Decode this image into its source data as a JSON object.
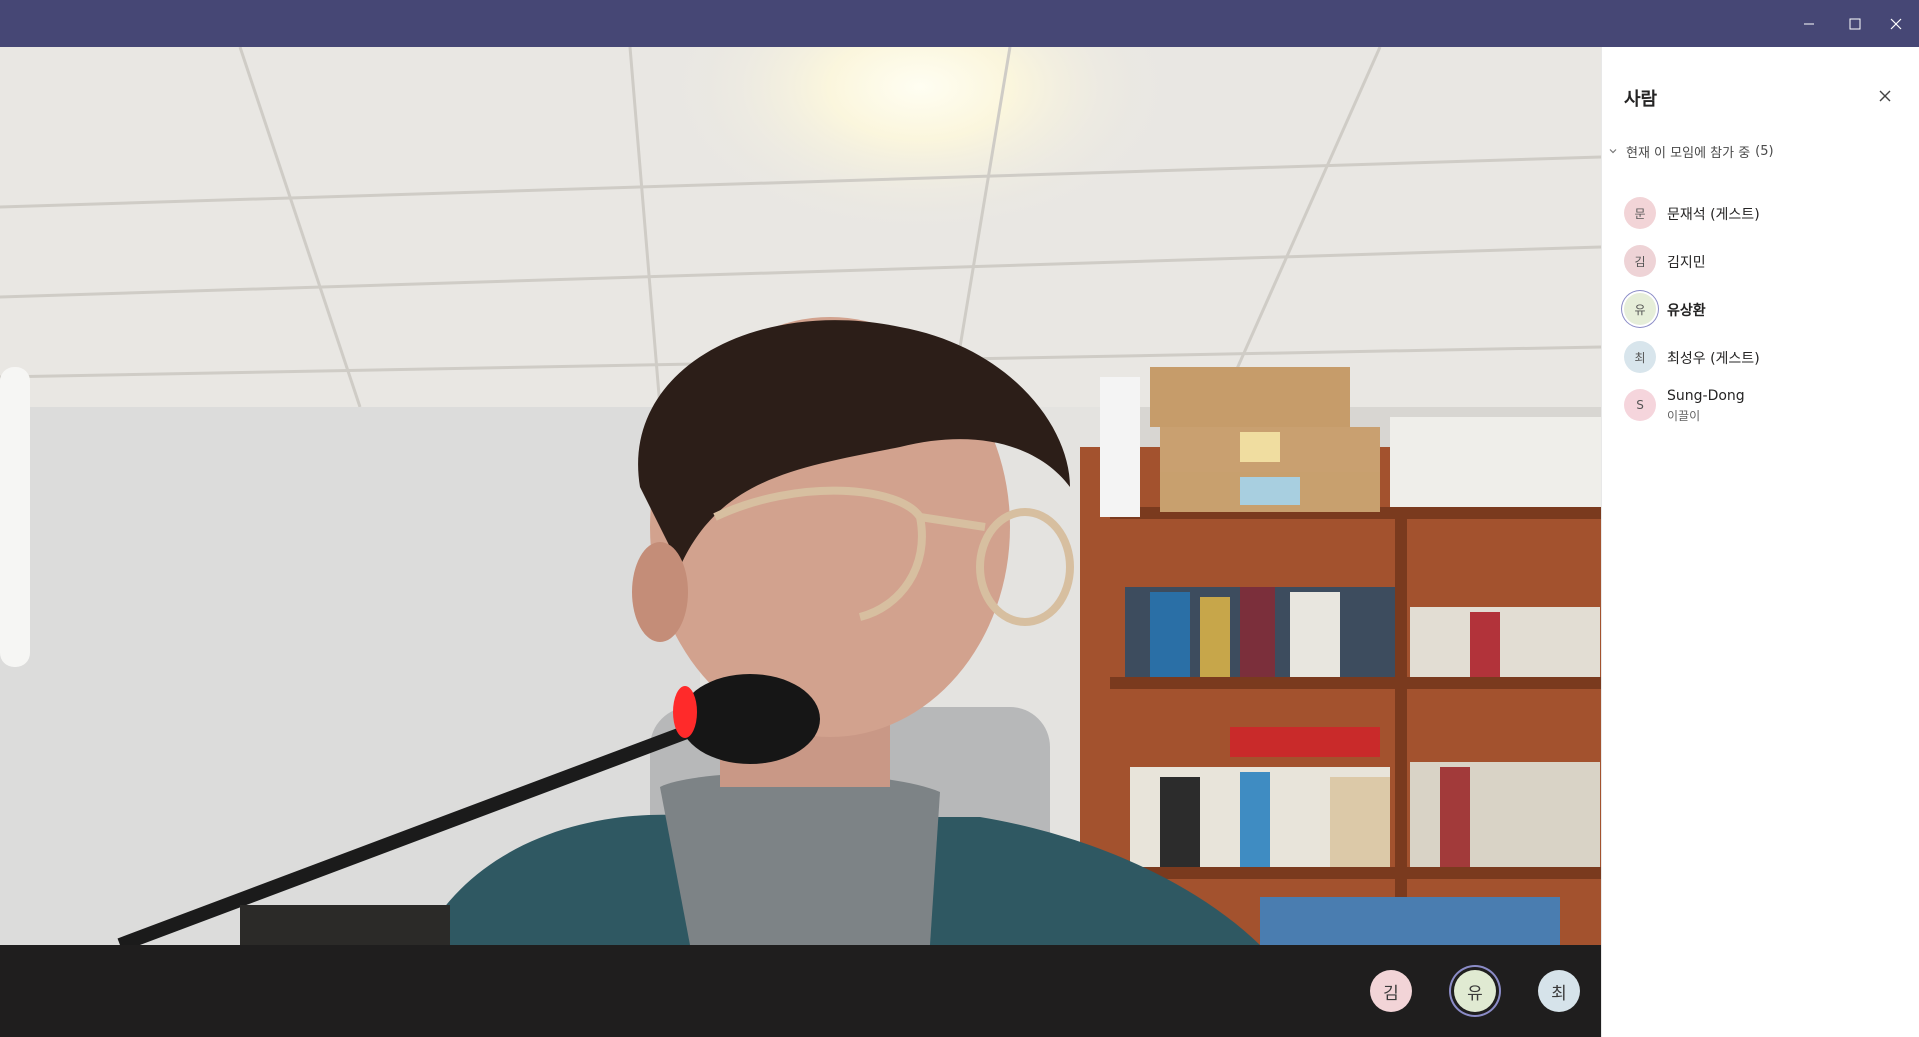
{
  "window": {
    "controls": {
      "minimize_icon": "minimize-icon",
      "maximize_icon": "maximize-icon",
      "close_icon": "close-icon"
    },
    "titlebar_color": "#464775"
  },
  "call": {
    "video_participant": "유상환",
    "participant_avatars": [
      {
        "initial": "김",
        "color": "#f2d4d7"
      },
      {
        "initial": "유",
        "color": "#e0ead2",
        "active": true
      },
      {
        "initial": "최",
        "color": "#d6e3ea"
      }
    ]
  },
  "people_panel": {
    "title": "사람",
    "section_label": "현재 이 모임에 참가 중",
    "section_count": "(5)",
    "participants": [
      {
        "initial": "문",
        "name": "문재석 (게스트)",
        "color": "#f2d4d7"
      },
      {
        "initial": "김",
        "name": "김지민",
        "color": "#eed3d6"
      },
      {
        "initial": "유",
        "name": "유상환",
        "color": "#e6eed9",
        "active": true
      },
      {
        "initial": "최",
        "name": "최성우 (게스트)",
        "color": "#d8e5ec"
      },
      {
        "initial": "S",
        "name": "Sung-Dong",
        "subtitle": "이끌이",
        "color": "#f5d5dc"
      }
    ]
  }
}
